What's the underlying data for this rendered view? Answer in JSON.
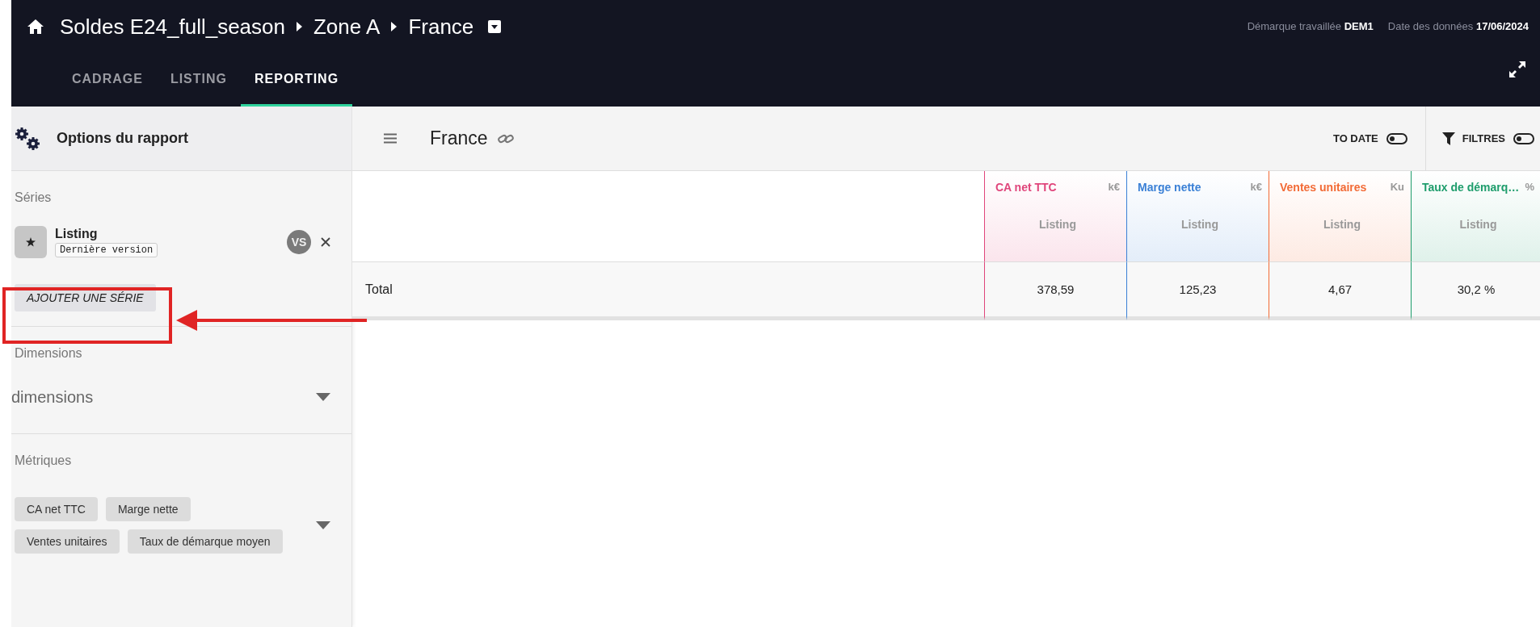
{
  "header": {
    "breadcrumb": [
      "Soldes E24_full_season",
      "Zone A",
      "France"
    ],
    "info": [
      {
        "label": "Démarque travaillée",
        "value": "DEM1"
      },
      {
        "label": "Date des données",
        "value": "17/06/2024"
      }
    ]
  },
  "tabs": [
    {
      "label": "CADRAGE",
      "selected": false
    },
    {
      "label": "LISTING",
      "selected": false
    },
    {
      "label": "REPORTING",
      "selected": true
    }
  ],
  "panel": {
    "title": "Options du rapport",
    "series_label": "Séries",
    "series": [
      {
        "name": "Listing",
        "version": "Dernière version",
        "badge": "VS"
      }
    ],
    "add_button": "AJOUTER UNE SÉRIE",
    "dimensions_label": "Dimensions",
    "dimensions_field": {
      "placeholder": "dimensions"
    },
    "metrics_label": "Métriques",
    "metrics": [
      "CA net TTC",
      "Marge nette",
      "Ventes unitaires",
      "Taux de démarque moyen"
    ]
  },
  "toolbar": {
    "title": "France",
    "to_date": {
      "label": "TO DATE",
      "on": false
    },
    "filters": {
      "label": "FILTRES",
      "on": false
    }
  },
  "table": {
    "columns": [
      {
        "name": "CA net TTC",
        "unit": "k€",
        "series": "Listing",
        "color": "#e0457b"
      },
      {
        "name": "Marge nette",
        "unit": "k€",
        "series": "Listing",
        "color": "#3a80d6"
      },
      {
        "name": "Ventes unitaires",
        "unit": "Ku",
        "series": "Listing",
        "color": "#f26a35"
      },
      {
        "name": "Taux de démarq…",
        "unit": "%",
        "series": "Listing",
        "color": "#1e9d6c"
      }
    ],
    "rows": [
      {
        "label": "Total",
        "values": [
          "378,59",
          "125,23",
          "4,67",
          "30,2 %"
        ]
      }
    ]
  }
}
